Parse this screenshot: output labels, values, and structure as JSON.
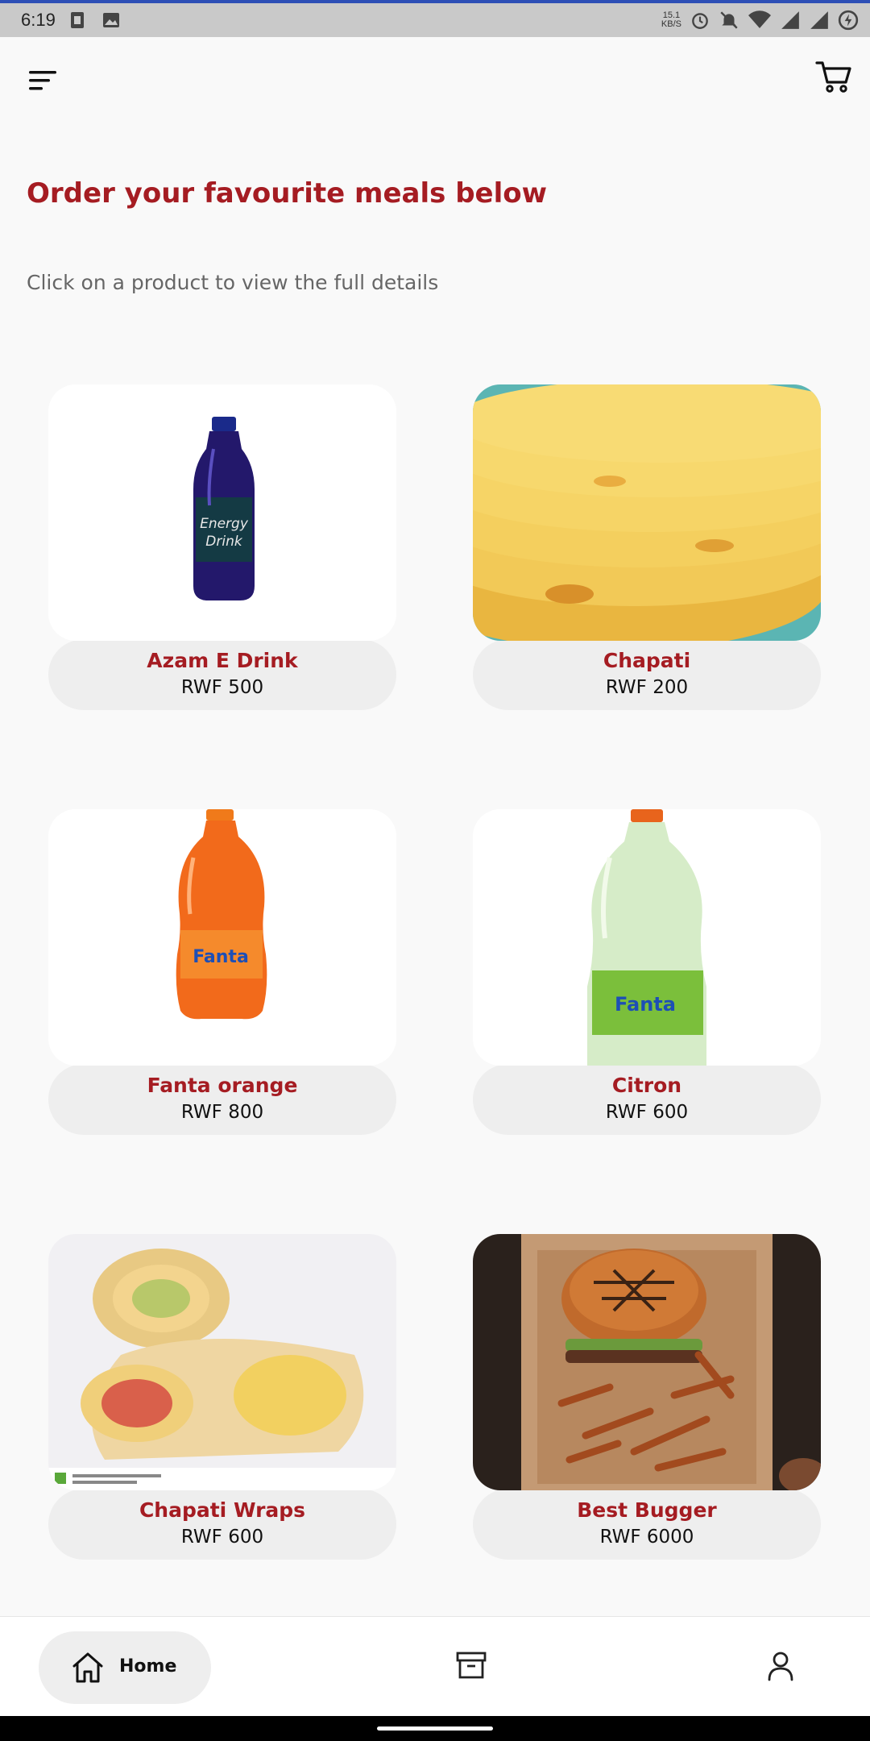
{
  "status_bar": {
    "time": "6:19",
    "speed_value": "15.1",
    "speed_unit": "KB/S",
    "icons": [
      "sim-icon",
      "image-icon",
      "alarm-icon",
      "mute-icon",
      "wifi-icon",
      "signal-icon",
      "signal-icon",
      "battery-icon"
    ]
  },
  "header": {
    "menu_icon": "menu-icon",
    "cart_icon": "cart-icon"
  },
  "main": {
    "title": "Order your favourite meals below",
    "subtitle": "Click on a product to view the full details",
    "products": [
      {
        "name": "Azam E Drink",
        "price": "RWF 500",
        "image": "energy-drink-bottle"
      },
      {
        "name": "Chapati",
        "price": "RWF 200",
        "image": "chapati-stack"
      },
      {
        "name": "Fanta orange",
        "price": "RWF 800",
        "image": "fanta-orange-bottle"
      },
      {
        "name": "Citron",
        "price": "RWF 600",
        "image": "fanta-citron-bottle"
      },
      {
        "name": "Chapati Wraps",
        "price": "RWF 600",
        "image": "chapati-wraps"
      },
      {
        "name": "Best Bugger",
        "price": "RWF 6000",
        "image": "burger-fries-box"
      }
    ]
  },
  "bottom_nav": {
    "home_label": "Home",
    "items": [
      "home-icon",
      "orders-icon",
      "profile-icon"
    ]
  },
  "colors": {
    "accent": "#a51c22",
    "background": "#f9f9f9",
    "pill": "#eeeeee"
  }
}
